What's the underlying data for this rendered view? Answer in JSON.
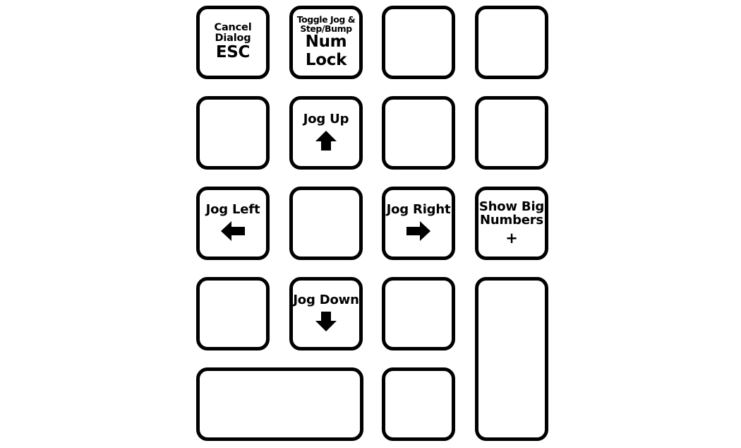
{
  "diagram": {
    "title": "Numeric keypad shortcut overlay",
    "colors": {
      "key_outline": "#000000",
      "key_face": "#ffffff",
      "text": "#000000",
      "background": "#ffffff"
    }
  },
  "keys": [
    {
      "id": "cancel-dialog-esc",
      "row": 1,
      "col": 1,
      "function_lines": [
        "Cancel",
        "Dialog"
      ],
      "legend_lines": [
        "ESC"
      ],
      "icon": null
    },
    {
      "id": "toggle-jog-step-bump-num-lock",
      "row": 1,
      "col": 2,
      "function_lines": [
        "Toggle Jog &",
        "Step/Bump"
      ],
      "legend_lines": [
        "Num",
        "Lock"
      ],
      "icon": null
    },
    {
      "id": "blank-r1c3",
      "row": 1,
      "col": 3,
      "function_lines": [],
      "legend_lines": [],
      "icon": null
    },
    {
      "id": "blank-r1c4",
      "row": 1,
      "col": 4,
      "function_lines": [],
      "legend_lines": [],
      "icon": null
    },
    {
      "id": "blank-r2c1",
      "row": 2,
      "col": 1,
      "function_lines": [],
      "legend_lines": [],
      "icon": null
    },
    {
      "id": "jog-up",
      "row": 2,
      "col": 2,
      "function_lines": [
        "Jog Up"
      ],
      "legend_lines": [],
      "icon": "arrow-up-icon"
    },
    {
      "id": "blank-r2c3",
      "row": 2,
      "col": 3,
      "function_lines": [],
      "legend_lines": [],
      "icon": null
    },
    {
      "id": "blank-r2c4",
      "row": 2,
      "col": 4,
      "function_lines": [],
      "legend_lines": [],
      "icon": null
    },
    {
      "id": "jog-left",
      "row": 3,
      "col": 1,
      "function_lines": [
        "Jog Left"
      ],
      "legend_lines": [],
      "icon": "arrow-left-icon"
    },
    {
      "id": "blank-r3c2",
      "row": 3,
      "col": 2,
      "function_lines": [],
      "legend_lines": [],
      "icon": null
    },
    {
      "id": "jog-right",
      "row": 3,
      "col": 3,
      "function_lines": [
        "Jog Right"
      ],
      "legend_lines": [],
      "icon": "arrow-right-icon"
    },
    {
      "id": "show-big-numbers-plus",
      "row": 3,
      "col": 4,
      "function_lines": [
        "Show Big",
        "Numbers"
      ],
      "legend_lines": [
        "+"
      ],
      "icon": null
    },
    {
      "id": "blank-r4c1",
      "row": 4,
      "col": 1,
      "function_lines": [],
      "legend_lines": [],
      "icon": null
    },
    {
      "id": "jog-down",
      "row": 4,
      "col": 2,
      "function_lines": [
        "Jog Down"
      ],
      "legend_lines": [],
      "icon": "arrow-down-icon"
    },
    {
      "id": "blank-r4c3",
      "row": 4,
      "col": 3,
      "function_lines": [],
      "legend_lines": [],
      "icon": null
    },
    {
      "id": "blank-tall-r4c4",
      "row": 4,
      "col": 4,
      "function_lines": [],
      "legend_lines": [],
      "icon": null
    },
    {
      "id": "blank-wide-r5c1",
      "row": 5,
      "col": 1,
      "function_lines": [],
      "legend_lines": [],
      "icon": null
    },
    {
      "id": "blank-r5c3",
      "row": 5,
      "col": 3,
      "function_lines": [],
      "legend_lines": [],
      "icon": null
    }
  ],
  "labels": {
    "cancel_line1": "Cancel",
    "cancel_line2": "Dialog",
    "cancel_legend": "ESC",
    "numlock_line1": "Toggle Jog &",
    "numlock_line2": "Step/Bump",
    "numlock_legend1": "Num",
    "numlock_legend2": "Lock",
    "jog_up": "Jog Up",
    "jog_left": "Jog Left",
    "jog_right": "Jog Right",
    "jog_down": "Jog Down",
    "bignum_line1": "Show Big",
    "bignum_line2": "Numbers",
    "bignum_legend": "+"
  }
}
